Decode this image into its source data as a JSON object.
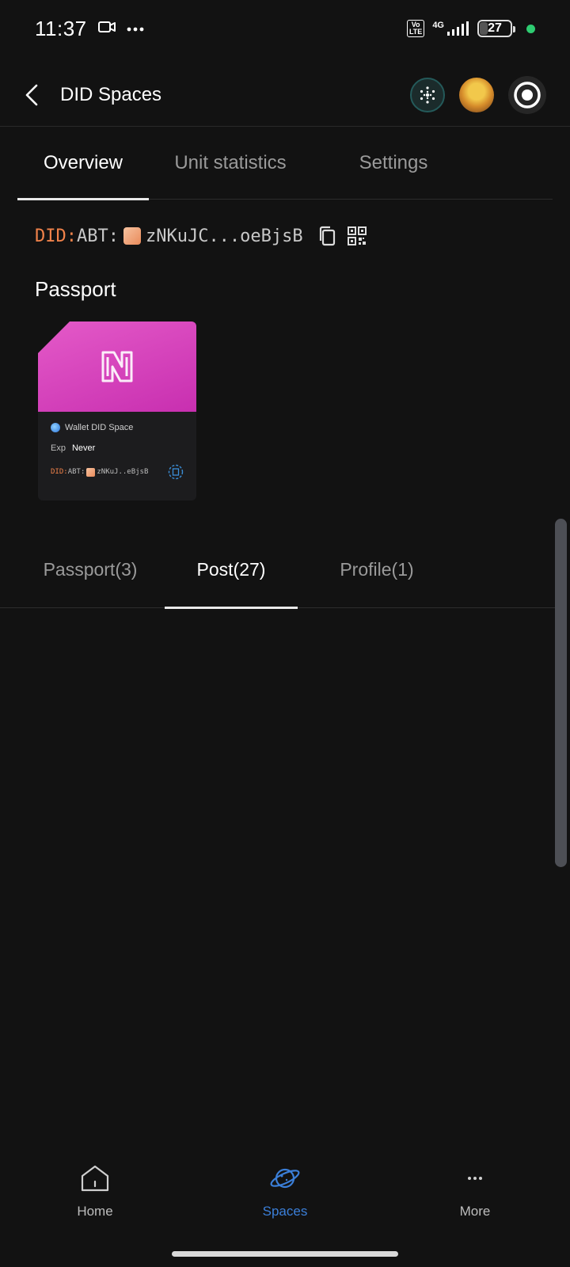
{
  "status_bar": {
    "time": "11:37",
    "network_badge": "Vo\nLTE",
    "network_type": "4G",
    "battery": "27",
    "icons": [
      "video-camera-icon",
      "more-dots-icon",
      "signal-icon"
    ]
  },
  "header": {
    "title": "DID Spaces",
    "actions": [
      "ai-assistant-icon",
      "user-avatar",
      "record-icon"
    ]
  },
  "top_tabs": [
    {
      "label": "Overview",
      "active": true
    },
    {
      "label": "Unit statistics",
      "active": false
    },
    {
      "label": "Settings",
      "active": false
    }
  ],
  "did": {
    "prefix": "DID:",
    "method": "ABT:",
    "value": "zNKuJC...oeBjsB",
    "icons": [
      "copy-icon",
      "qr-code-icon"
    ]
  },
  "passport": {
    "heading": "Passport",
    "card": {
      "name": "Wallet DID Space",
      "exp_label": "Exp",
      "exp_value": "Never",
      "did_prefix": "DID:",
      "did_method": "ABT:",
      "did_value": "zNKuJ..eBjsB",
      "accent": "#d83cbd"
    }
  },
  "content_tabs": [
    {
      "label": "Passport(3)",
      "active": false
    },
    {
      "label": "Post(27)",
      "active": true
    },
    {
      "label": "Profile(1)",
      "active": false
    }
  ],
  "bottom_nav": [
    {
      "label": "Home",
      "icon": "home-icon",
      "active": false
    },
    {
      "label": "Spaces",
      "icon": "planet-icon",
      "active": true
    },
    {
      "label": "More",
      "icon": "more-dots-icon",
      "active": false
    }
  ],
  "colors": {
    "background": "#121212",
    "did_prefix": "#f0824a",
    "active_nav": "#3b7fd9"
  }
}
